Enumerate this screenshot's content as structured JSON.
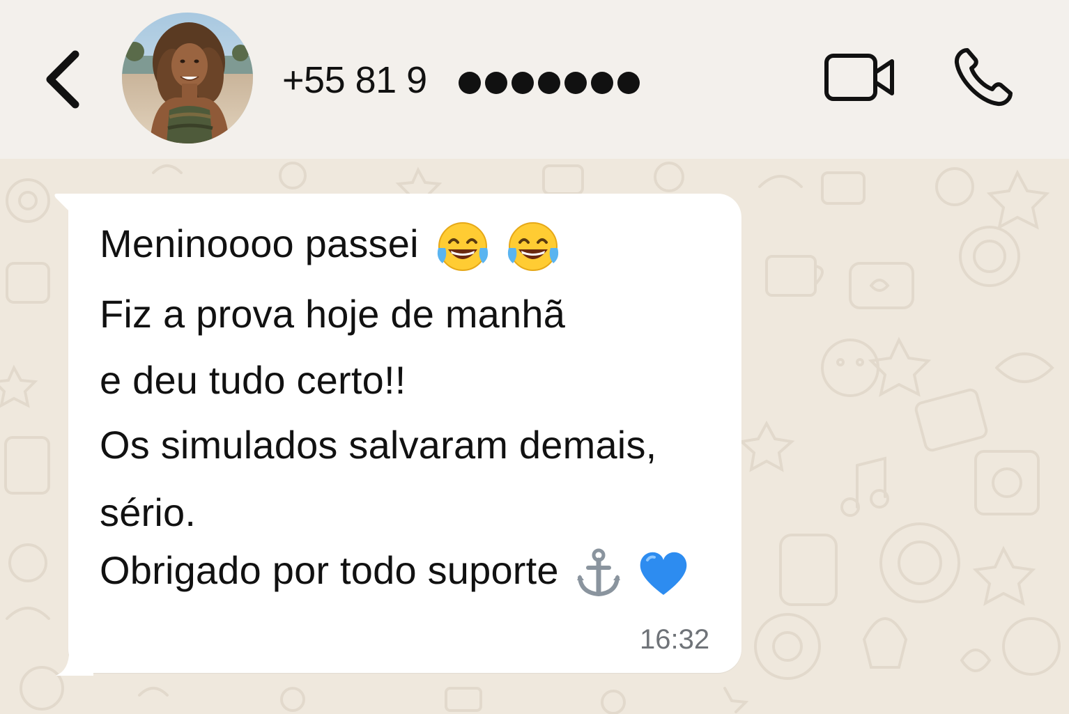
{
  "header": {
    "contact_name": "+55 81 9",
    "masked_digits_count": 7,
    "icons": {
      "back": "chevron-left-icon",
      "video": "video-camera-icon",
      "call": "phone-icon"
    }
  },
  "message": {
    "lines": [
      "Meninoooo passei",
      "Fiz a prova hoje de manhã",
      "e deu tudo certo!!",
      "Os simulados salvaram demais,",
      "sério.",
      "Obrigado por todo suporte"
    ],
    "emojis": {
      "line_1": [
        "tears-of-joy-emoji",
        "tears-of-joy-emoji"
      ],
      "line_6": [
        "anchor-emoji",
        "blue-heart-emoji"
      ]
    },
    "time": "16:32"
  },
  "colors": {
    "header_bg": "#f3f0ec",
    "chat_bg": "#efe8dd",
    "bubble_bg": "#ffffff",
    "text": "#111111",
    "timestamp": "#6f7378",
    "heart": "#2d8cf0"
  }
}
